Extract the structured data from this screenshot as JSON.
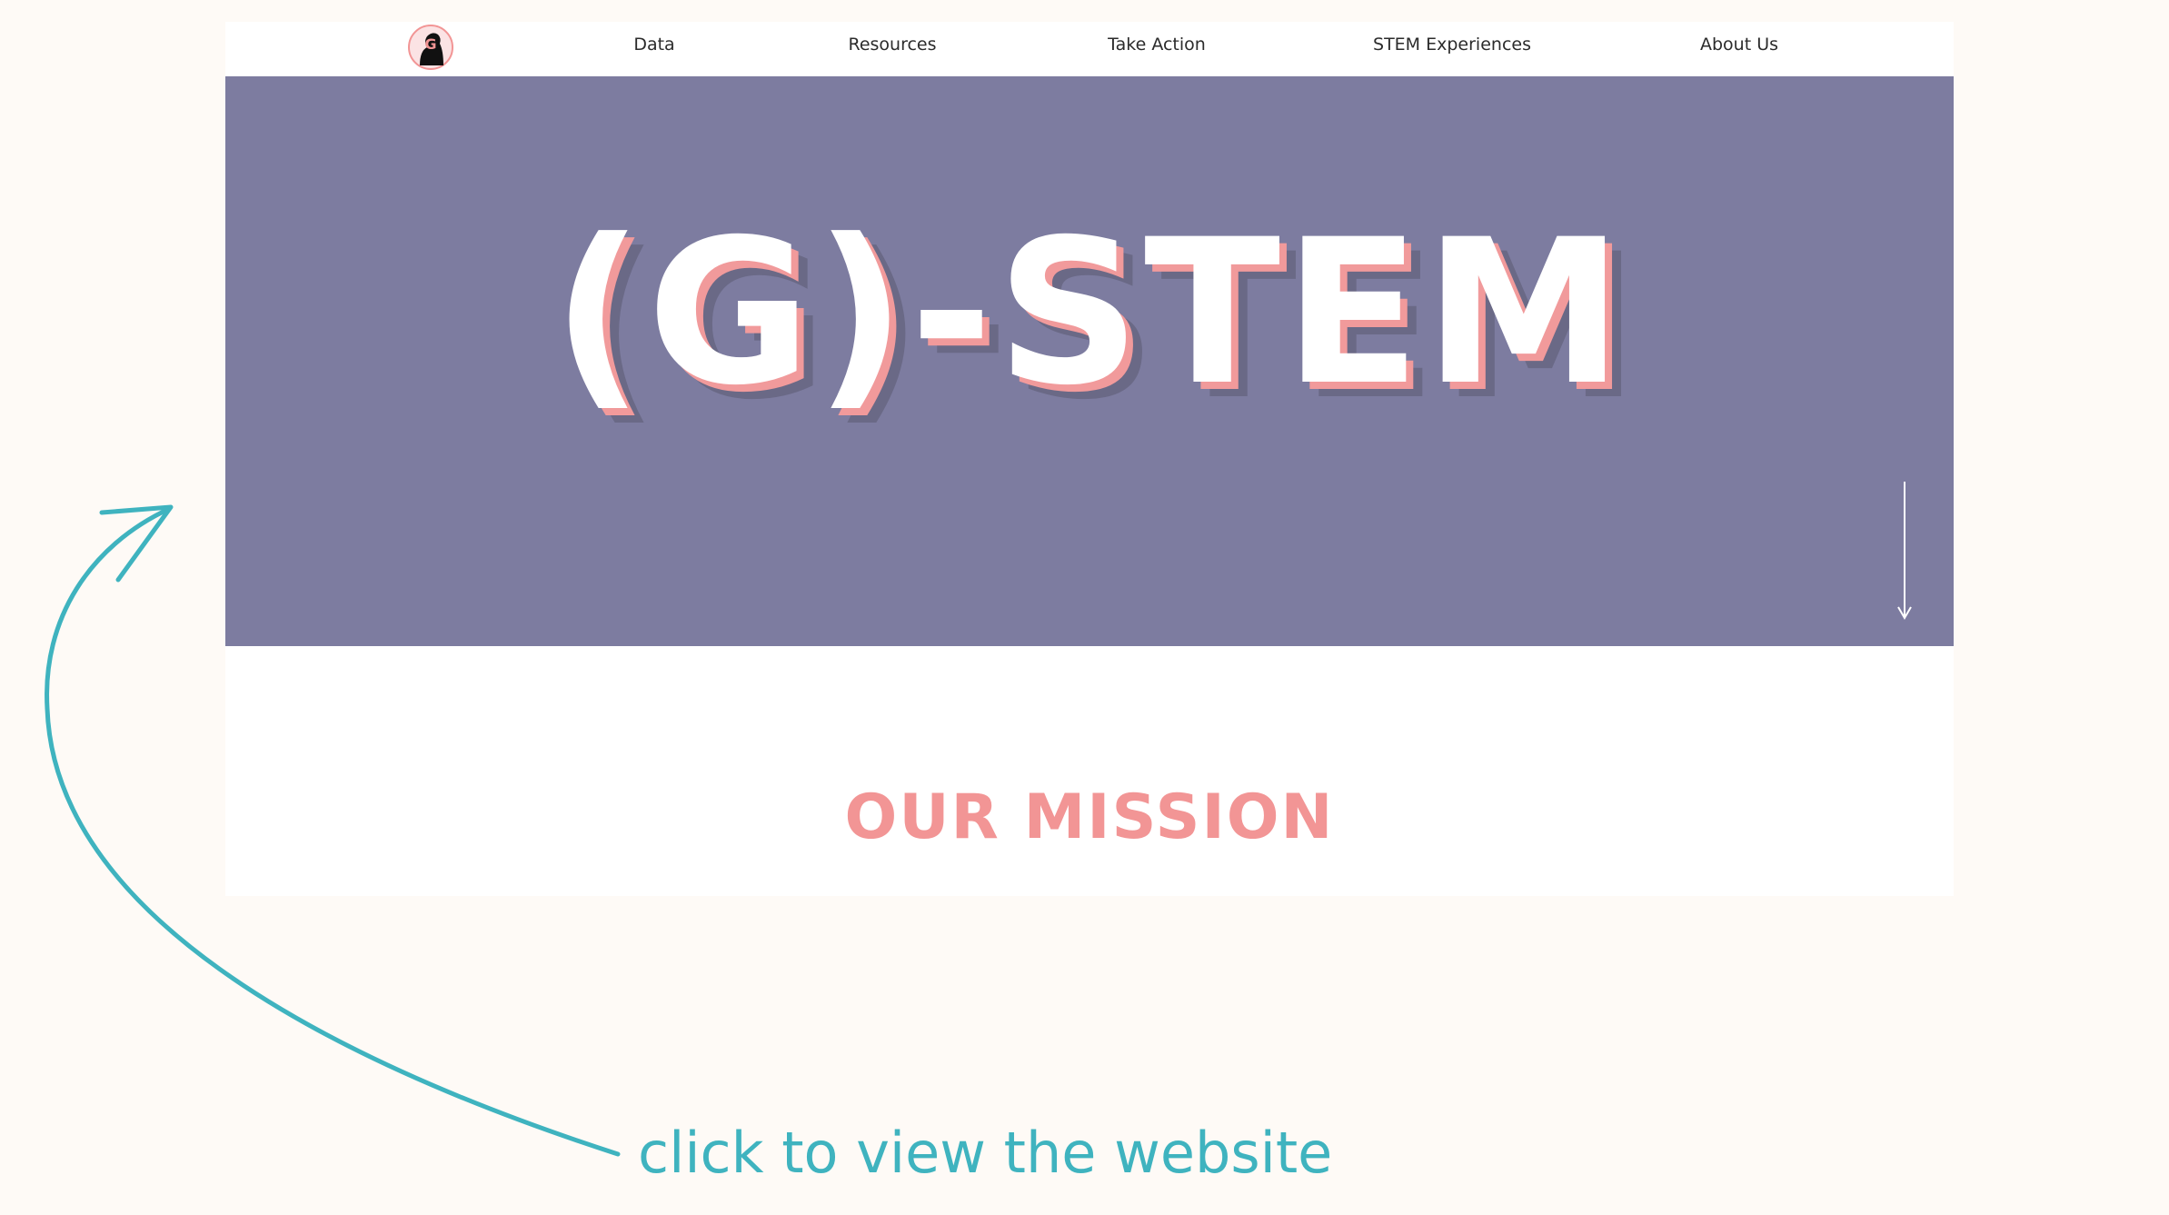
{
  "nav": {
    "items": [
      {
        "label": "Data"
      },
      {
        "label": "Resources"
      },
      {
        "label": "Take Action"
      },
      {
        "label": "STEM Experiences"
      },
      {
        "label": "About Us"
      }
    ]
  },
  "hero": {
    "title": "(G)-STEM"
  },
  "mission": {
    "heading": "OUR MISSION"
  },
  "annotation": {
    "cta": "click to view the website"
  },
  "colors": {
    "page_bg": "#fefaf6",
    "hero_bg": "#7d7ca0",
    "accent_pink": "#f29595",
    "accent_teal": "#3fb3bf"
  },
  "icons": {
    "logo": "g-stem-logo-icon",
    "scroll": "arrow-down-icon",
    "annotation": "curved-arrow-icon"
  }
}
